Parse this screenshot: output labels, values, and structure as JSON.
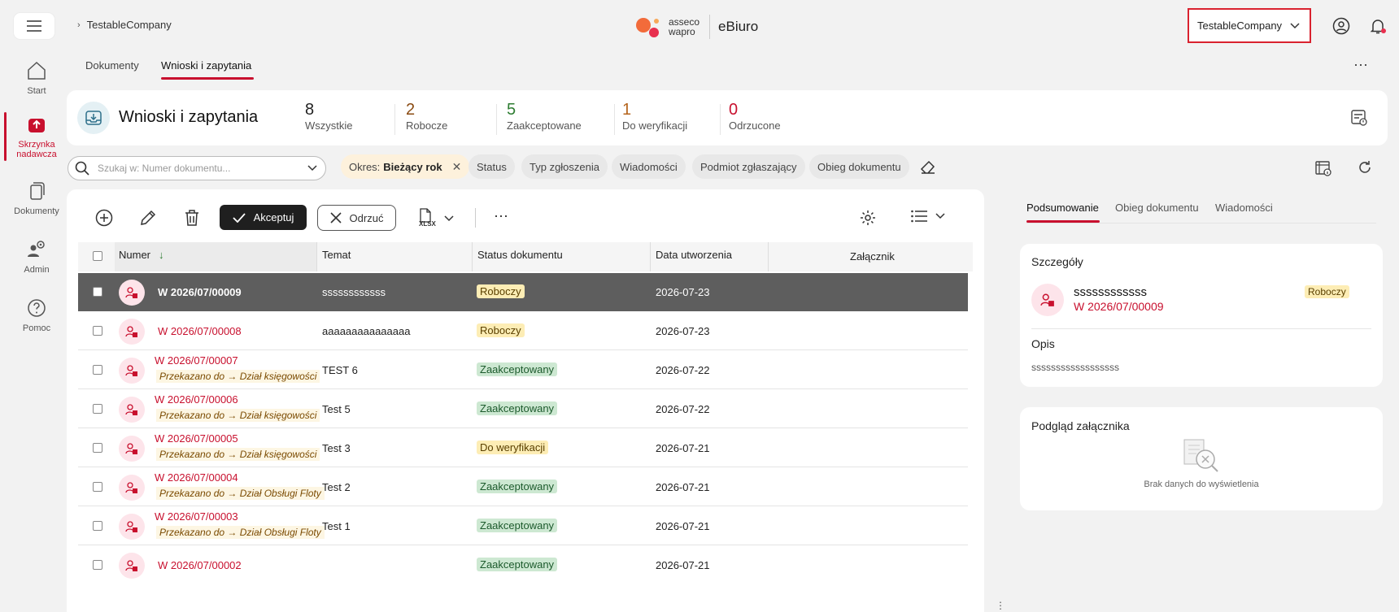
{
  "topbar": {
    "breadcrumb": "TestableCompany",
    "logo_line1": "asseco",
    "logo_line2": "wapro",
    "app_name": "eBiuro",
    "company_selector": "TestableCompany"
  },
  "nav": [
    {
      "label": "Start",
      "icon": "home-icon"
    },
    {
      "label1": "Skrzynka",
      "label2": "nadawcza",
      "icon": "outbox-icon"
    },
    {
      "label": "Dokumenty",
      "icon": "documents-icon"
    },
    {
      "label": "Admin",
      "icon": "admin-icon"
    },
    {
      "label": "Pomoc",
      "icon": "help-icon"
    }
  ],
  "tabs": [
    "Dokumenty",
    "Wnioski i zapytania"
  ],
  "header": {
    "title": "Wnioski i zapytania",
    "stats": [
      {
        "value": "8",
        "label": "Wszystkie",
        "color": "#222222"
      },
      {
        "value": "2",
        "label": "Robocze",
        "color": "#8a4b12"
      },
      {
        "value": "5",
        "label": "Zaakceptowane",
        "color": "#2e7d32"
      },
      {
        "value": "1",
        "label": "Do weryfikacji",
        "color": "#b5651d"
      },
      {
        "value": "0",
        "label": "Odrzucone",
        "color": "#c8102e"
      }
    ]
  },
  "filters": {
    "search_placeholder": "Szukaj w: Numer dokumentu...",
    "period_label": "Okres:",
    "period_value": "Bieżący rok",
    "chips": [
      "Status",
      "Typ zgłoszenia",
      "Wiadomości",
      "Podmiot zgłaszający",
      "Obieg dokumentu"
    ]
  },
  "toolbar": {
    "accept_label": "Akceptuj",
    "reject_label": "Odrzuć",
    "xlsx_label": "XLSX"
  },
  "table": {
    "columns": [
      "Numer",
      "Temat",
      "Status dokumentu",
      "Data utworzenia",
      "Załącznik"
    ],
    "rows": [
      {
        "number": "W 2026/07/00009",
        "forward": "",
        "subject": "ssssssssssss",
        "status": "Roboczy",
        "status_color": "yellow",
        "date": "2026-07-23"
      },
      {
        "number": "W 2026/07/00008",
        "forward": "",
        "subject": "aaaaaaaaaaaaaaa",
        "status": "Roboczy",
        "status_color": "yellow",
        "date": "2026-07-23"
      },
      {
        "number": "W 2026/07/00007",
        "forward": "Przekazano do → Dział księgowości",
        "subject": "TEST 6",
        "status": "Zaakceptowany",
        "status_color": "green",
        "date": "2026-07-22"
      },
      {
        "number": "W 2026/07/00006",
        "forward": "Przekazano do → Dział księgowości",
        "subject": "Test 5",
        "status": "Zaakceptowany",
        "status_color": "green",
        "date": "2026-07-22"
      },
      {
        "number": "W 2026/07/00005",
        "forward": "Przekazano do → Dział księgowości",
        "subject": "Test 3",
        "status": "Do weryfikacji",
        "status_color": "yellow",
        "date": "2026-07-21"
      },
      {
        "number": "W 2026/07/00004",
        "forward": "Przekazano do → Dział Obsługi Floty",
        "subject": "Test 2",
        "status": "Zaakceptowany",
        "status_color": "green",
        "date": "2026-07-21"
      },
      {
        "number": "W 2026/07/00003",
        "forward": "Przekazano do → Dział Obsługi Floty",
        "subject": "Test 1",
        "status": "Zaakceptowany",
        "status_color": "green",
        "date": "2026-07-21"
      },
      {
        "number": "W 2026/07/00002",
        "forward": "",
        "subject": "",
        "status": "Zaakceptowany",
        "status_color": "green",
        "date": "2026-07-21"
      }
    ]
  },
  "panel": {
    "tabs": [
      "Podsumowanie",
      "Obieg dokumentu",
      "Wiadomości"
    ],
    "details_title": "Szczegóły",
    "subject": "ssssssssssss",
    "number": "W 2026/07/00009",
    "status": "Roboczy",
    "desc_label": "Opis",
    "desc_value": "ssssssssssssssssss",
    "attachment_title": "Podgląd załącznika",
    "no_data": "Brak danych do wyświetlenia"
  }
}
